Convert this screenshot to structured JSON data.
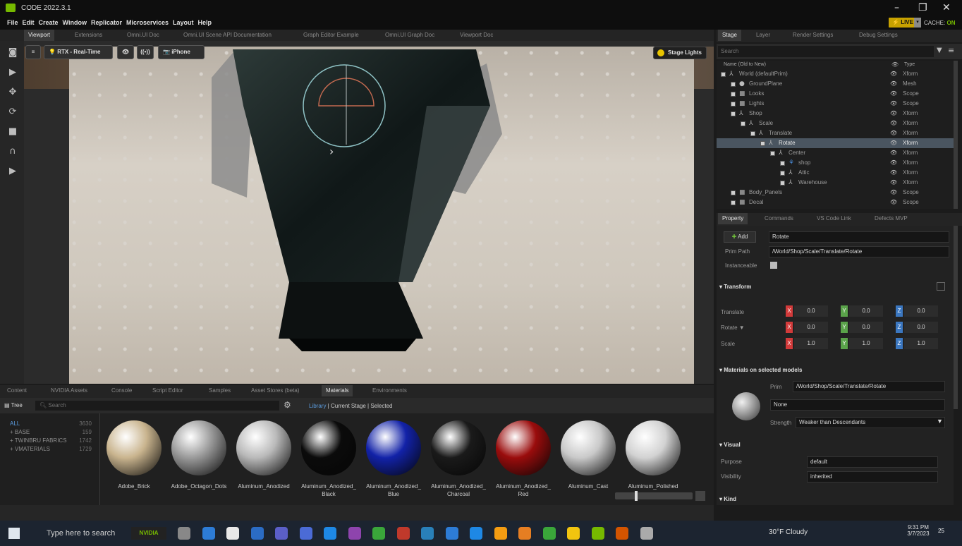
{
  "window": {
    "title": "CODE 2022.3.1"
  },
  "menu": [
    "File",
    "Edit",
    "Create",
    "Window",
    "Replicator",
    "Microservices",
    "Layout",
    "Help"
  ],
  "status": {
    "live_label": "LIVE",
    "cache_label": "CACHE:",
    "cache_value": "ON"
  },
  "viewport_tabs": [
    "Viewport",
    "Extensions",
    "Omni.UI Doc",
    "Omni.UI Scene API Documentation",
    "Graph Editor Example",
    "Omni.UI Graph Doc",
    "Viewport Doc"
  ],
  "viewport": {
    "render_mode": "RTX - Real-Time",
    "camera": "iPhone",
    "stage_lights": "Stage Lights",
    "playhead_glyph": "›"
  },
  "bottom_tabs": [
    "Content",
    "NVIDIA Assets",
    "Console",
    "Script Editor",
    "Samples",
    "Asset Stores (beta)",
    "Materials",
    "Environments"
  ],
  "materials": {
    "tree_label": "Tree",
    "search_placeholder": "Search",
    "filters": [
      "Library",
      "Current Stage",
      "Selected"
    ],
    "categories": [
      {
        "name": "ALL",
        "count": "3630"
      },
      {
        "name": "+ BASE",
        "count": "159"
      },
      {
        "name": "+ TWINBRU FABRICS",
        "count": "1742"
      },
      {
        "name": "+ VMATERIALS",
        "count": "1729"
      }
    ],
    "items": [
      {
        "name": "Adobe_Brick",
        "color": "#c9b48e"
      },
      {
        "name": "Adobe_Octagon_Dots",
        "color": "#9a9a9a"
      },
      {
        "name": "Aluminum_Anodized",
        "color": "#b9b9b9"
      },
      {
        "name": "Aluminum_Anodized_ Black",
        "color": "#0b0b0b"
      },
      {
        "name": "Aluminum_Anodized_ Blue",
        "color": "#1222a8"
      },
      {
        "name": "Aluminum_Anodized_ Charcoal",
        "color": "#1a1a1a"
      },
      {
        "name": "Aluminum_Anodized_ Red",
        "color": "#9a0c0c"
      },
      {
        "name": "Aluminum_Cast",
        "color": "#c9c9c9"
      },
      {
        "name": "Aluminum_Polished",
        "color": "#d2d2d2"
      }
    ]
  },
  "stage": {
    "tabs": [
      "Stage",
      "Layer",
      "Render Settings",
      "Debug Settings"
    ],
    "search_placeholder": "Search",
    "col_name": "Name (Old to New)",
    "col_type": "Type",
    "tree": [
      {
        "name": "World (defaultPrim)",
        "type": "Xform",
        "depth": 0,
        "icon": "xform",
        "selected": false
      },
      {
        "name": "GroundPlane",
        "type": "Mesh",
        "depth": 1,
        "icon": "mesh",
        "selected": false
      },
      {
        "name": "Looks",
        "type": "Scope",
        "depth": 1,
        "icon": "folder",
        "selected": false
      },
      {
        "name": "Lights",
        "type": "Scope",
        "depth": 1,
        "icon": "folder",
        "selected": false
      },
      {
        "name": "Shop",
        "type": "Xform",
        "depth": 1,
        "icon": "xform",
        "selected": false
      },
      {
        "name": "Scale",
        "type": "Xform",
        "depth": 2,
        "icon": "xform",
        "selected": false
      },
      {
        "name": "Translate",
        "type": "Xform",
        "depth": 3,
        "icon": "xform",
        "selected": false
      },
      {
        "name": "Rotate",
        "type": "Xform",
        "depth": 4,
        "icon": "xform",
        "selected": true
      },
      {
        "name": "Center",
        "type": "Xform",
        "depth": 5,
        "icon": "xform",
        "selected": false
      },
      {
        "name": "shop",
        "type": "Xform",
        "depth": 6,
        "icon": "skel",
        "selected": false
      },
      {
        "name": "Attic",
        "type": "Xform",
        "depth": 6,
        "icon": "xform",
        "selected": false
      },
      {
        "name": "Warehouse",
        "type": "Xform",
        "depth": 6,
        "icon": "xform",
        "selected": false
      },
      {
        "name": "Body_Panels",
        "type": "Scope",
        "depth": 1,
        "icon": "folder",
        "selected": false
      },
      {
        "name": "Decal",
        "type": "Scope",
        "depth": 1,
        "icon": "folder",
        "selected": false
      }
    ]
  },
  "property": {
    "tabs": [
      "Property",
      "Commands",
      "VS Code Link",
      "Defects MVP"
    ],
    "add_label": "Add",
    "name_value": "Rotate",
    "prim_path_label": "Prim Path",
    "prim_path_value": "/World/Shop/Scale/Translate/Rotate",
    "instanceable_label": "Instanceable",
    "transform_section": "Transform",
    "translate_label": "Translate",
    "rotate_label": "Rotate ▼",
    "scale_label": "Scale",
    "translate": [
      "0.0",
      "0.0",
      "0.0"
    ],
    "rotate": [
      "0.0",
      "0.0",
      "0.0"
    ],
    "scale": [
      "1.0",
      "1.0",
      "1.0"
    ],
    "axis_labels": [
      "X",
      "Y",
      "Z"
    ],
    "materials_section": "Materials on selected models",
    "mat_prim_label": "Prim",
    "mat_prim_value": "/World/Shop/Scale/Translate/Rotate",
    "mat_value": "None",
    "strength_label": "Strength",
    "strength_value": "Weaker than Descendants",
    "visual_section": "Visual",
    "purpose_label": "Purpose",
    "purpose_value": "default",
    "visibility_label": "Visibility",
    "visibility_value": "inherited",
    "kind_section": "Kind"
  },
  "taskbar": {
    "search_placeholder": "Type here to search",
    "nvidia_label": "NVIDIA",
    "weather": "30°F  Cloudy",
    "time": "9:31 PM",
    "date": "3/7/2023",
    "notif_count": "25"
  }
}
